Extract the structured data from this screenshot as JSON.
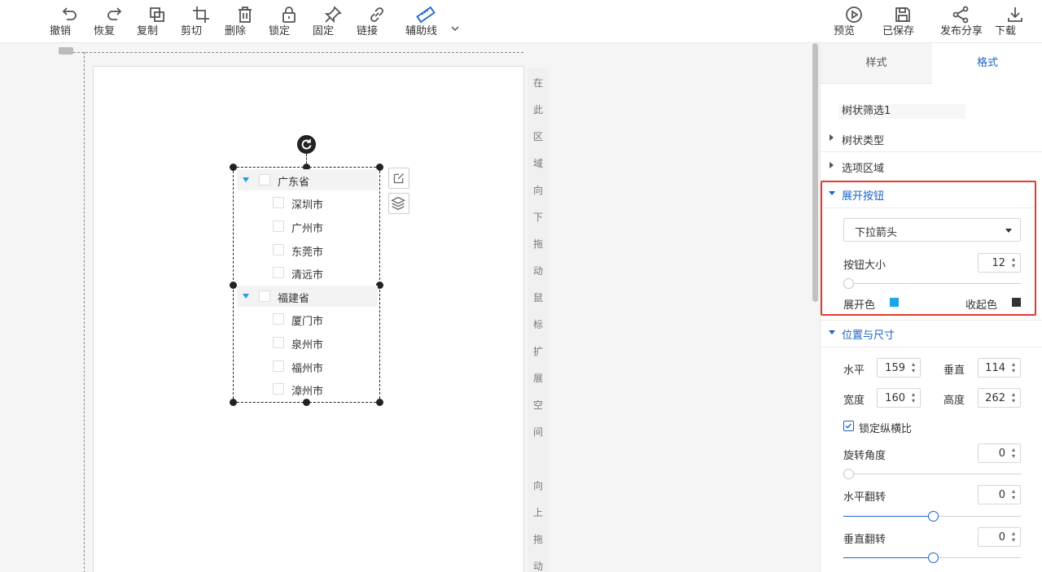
{
  "toolbar": {
    "left_buttons": [
      {
        "label": "撤销",
        "icon": "undo-icon"
      },
      {
        "label": "恢复",
        "icon": "redo-icon"
      },
      {
        "label": "复制",
        "icon": "copy-icon"
      },
      {
        "label": "剪切",
        "icon": "crop-icon"
      },
      {
        "label": "删除",
        "icon": "trash-icon"
      },
      {
        "label": "锁定",
        "icon": "lock-icon"
      },
      {
        "label": "固定",
        "icon": "pin-icon"
      },
      {
        "label": "链接",
        "icon": "link-icon"
      },
      {
        "label": "辅助线",
        "icon": "ruler-icon",
        "active": true
      }
    ],
    "right_buttons": [
      {
        "label": "预览",
        "icon": "play-icon"
      },
      {
        "label": "已保存",
        "icon": "save-icon"
      },
      {
        "label": "发布分享",
        "icon": "share-icon"
      },
      {
        "label": "下载",
        "icon": "download-icon"
      }
    ],
    "accent_color": "#1a63c8"
  },
  "canvas": {
    "side_hint_chars": [
      "在",
      "此",
      "区",
      "域",
      "向",
      "下",
      "拖",
      "动",
      "鼠",
      "标",
      "扩",
      "展",
      "空",
      "间",
      "",
      "向",
      "上",
      "拖",
      "动"
    ]
  },
  "tree": {
    "groups": [
      {
        "label": "广东省",
        "children": [
          "深圳市",
          "广州市",
          "东莞市",
          "清远市"
        ]
      },
      {
        "label": "福建省",
        "children": [
          "厦门市",
          "泉州市",
          "福州市",
          "漳州市"
        ]
      }
    ],
    "arrow_color": "#1fa3de"
  },
  "panel": {
    "tabs": {
      "style": "样式",
      "format": "格式"
    },
    "component_name": "树状筛选1",
    "sections": {
      "tree_type": "树状类型",
      "option_area": "选项区域",
      "expand_button": "展开按钮",
      "position_size": "位置与尺寸"
    },
    "expand": {
      "type_select": "下拉箭头",
      "size_label": "按钮大小",
      "size_value": "12",
      "size_slider_fraction": 0.0,
      "expand_color_label": "展开色",
      "expand_color": "#1aa7e8",
      "collapse_color_label": "收起色",
      "collapse_color": "#333333"
    },
    "position": {
      "x_label": "水平",
      "x_value": "159",
      "y_label": "垂直",
      "y_value": "114",
      "w_label": "宽度",
      "w_value": "160",
      "h_label": "高度",
      "h_value": "262",
      "lock_ratio_label": "锁定纵横比",
      "lock_ratio_checked": true,
      "rotate_label": "旋转角度",
      "rotate_value": "0",
      "rotate_slider_fraction": 0.0,
      "hflip_label": "水平翻转",
      "hflip_value": "0",
      "hflip_slider_fraction": 0.5,
      "vflip_label": "垂直翻转",
      "vflip_value": "0",
      "vflip_slider_fraction": 0.5
    },
    "highlight_color": "#e23b32"
  }
}
